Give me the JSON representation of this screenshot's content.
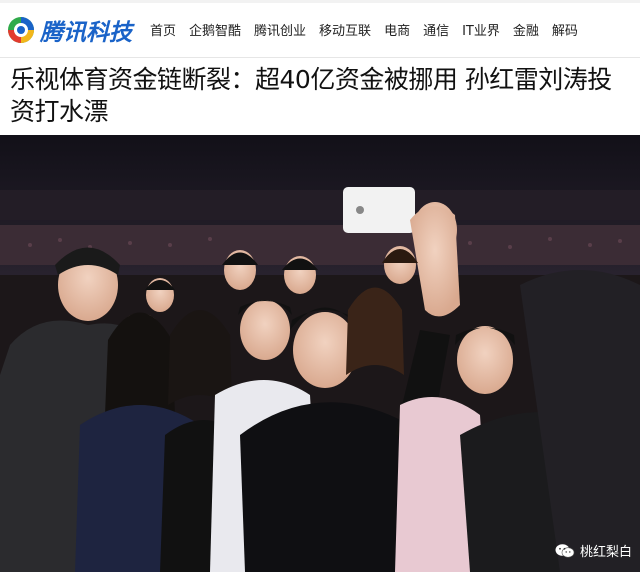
{
  "site": {
    "logo_text": "腾讯科技",
    "logo_colors": {
      "blue": "#1a63c8",
      "green": "#2faa4a",
      "yellow": "#f2b61b",
      "red": "#e23a2e"
    }
  },
  "nav": {
    "items": [
      "首页",
      "企鹅智酷",
      "腾讯创业",
      "移动互联",
      "电商",
      "通信",
      "IT业界",
      "金融",
      "解码"
    ]
  },
  "article": {
    "headline": "乐视体育资金链断裂：超40亿资金被挪用 孙红雷刘涛投资打水漂"
  },
  "photo": {
    "watermark": "桃红梨白",
    "watermark_icon": "wechat-icon"
  }
}
